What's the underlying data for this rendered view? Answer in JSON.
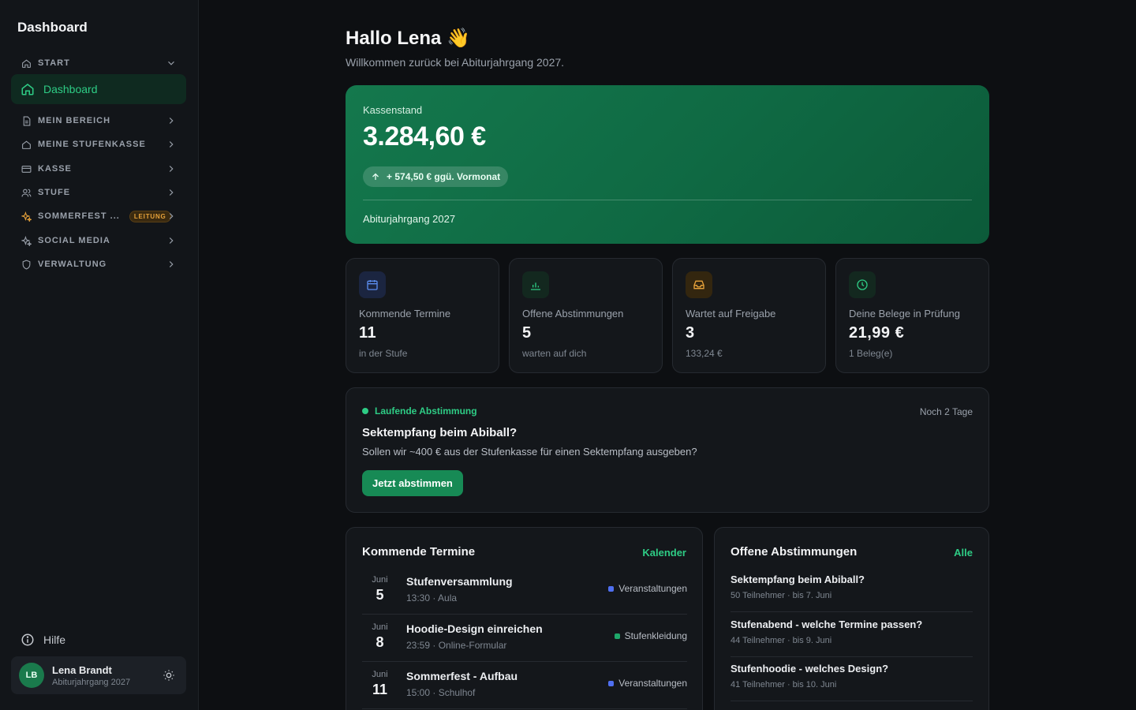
{
  "sidebar": {
    "brand": "Dashboard",
    "start_label": "START",
    "active_item": "Dashboard",
    "sections": [
      {
        "label": "MEIN BEREICH",
        "icon": "file-icon"
      },
      {
        "label": "MEINE STUFENKASSE",
        "icon": "home-icon"
      },
      {
        "label": "KASSE",
        "icon": "card-icon"
      },
      {
        "label": "STUFE",
        "icon": "users-icon"
      },
      {
        "label": "SOMMERFEST ...",
        "icon": "sparkle-icon",
        "badge": "LEITUNG"
      },
      {
        "label": "SOCIAL MEDIA",
        "icon": "sparkle-icon"
      },
      {
        "label": "VERWALTUNG",
        "icon": "shield-icon"
      }
    ],
    "help": "Hilfe",
    "user": {
      "initials": "LB",
      "name": "Lena Brandt",
      "subtitle": "Abiturjahrgang 2027"
    }
  },
  "header": {
    "title": "Hallo Lena",
    "emoji": "👋",
    "subtitle": "Willkommen zurück bei Abiturjahrgang 2027."
  },
  "balance": {
    "label": "Kassenstand",
    "amount": "3.284,60 €",
    "change": "+ 574,50 € ggü. Vormonat",
    "footer": "Abiturjahrgang 2027"
  },
  "stats": [
    {
      "label": "Kommende Termine",
      "value": "11",
      "sub": "in der Stufe",
      "icon": "calendar-icon",
      "color": "#5b8def",
      "bg": "#1b2540"
    },
    {
      "label": "Offene Abstimmungen",
      "value": "5",
      "sub": "warten auf dich",
      "icon": "bar-chart-icon",
      "color": "#2ecc85",
      "bg": "#13281f"
    },
    {
      "label": "Wartet auf Freigabe",
      "value": "3",
      "sub": "133,24 €",
      "icon": "inbox-icon",
      "color": "#e7a23a",
      "bg": "#33260f"
    },
    {
      "label": "Deine Belege in Prüfung",
      "value": "21,99 €",
      "sub": "1 Beleg(e)",
      "icon": "clock-icon",
      "color": "#2ecc85",
      "bg": "#13281f"
    }
  ],
  "current_vote": {
    "tag": "Laufende Abstimmung",
    "remaining": "Noch 2 Tage",
    "title": "Sektempfang beim Abiball?",
    "description": "Sollen wir ~400 € aus der Stufenkasse für einen Sektempfang ausgeben?",
    "button": "Jetzt abstimmen"
  },
  "events_panel": {
    "title": "Kommende Termine",
    "link": "Kalender",
    "items": [
      {
        "month": "Juni",
        "day": "5",
        "name": "Stufenversammlung",
        "meta": "13:30 · Aula",
        "category": "Veranstaltungen",
        "color": "#4f6ff0"
      },
      {
        "month": "Juni",
        "day": "8",
        "name": "Hoodie-Design einreichen",
        "meta": "23:59 · Online-Formular",
        "category": "Stufenkleidung",
        "color": "#1ea86a"
      },
      {
        "month": "Juni",
        "day": "11",
        "name": "Sommerfest - Aufbau",
        "meta": "15:00 · Schulhof",
        "category": "Veranstaltungen",
        "color": "#4f6ff0"
      }
    ]
  },
  "polls_panel": {
    "title": "Offene Abstimmungen",
    "link": "Alle",
    "items": [
      {
        "title": "Sektempfang beim Abiball?",
        "meta": "50 Teilnehmer · bis 7. Juni"
      },
      {
        "title": "Stufenabend - welche Termine passen?",
        "meta": "44 Teilnehmer · bis 9. Juni"
      },
      {
        "title": "Stufenhoodie - welches Design?",
        "meta": "41 Teilnehmer · bis 10. Juni"
      }
    ]
  }
}
